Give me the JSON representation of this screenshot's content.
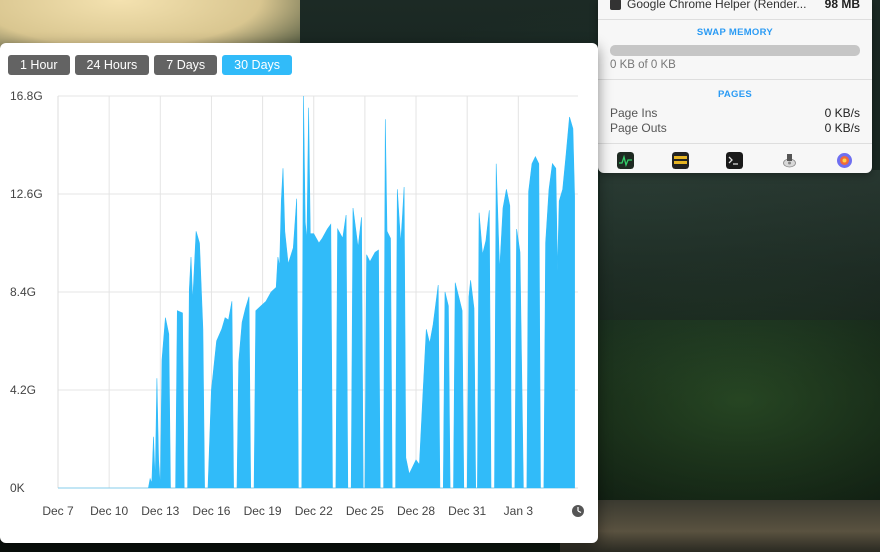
{
  "memory_panel": {
    "process_row": {
      "name": "Google Chrome Helper (Render...",
      "value": "98 MB"
    },
    "swap": {
      "heading": "SWAP MEMORY",
      "usage_text": "0 KB of 0 KB",
      "fill_fraction": 0
    },
    "pages": {
      "heading": "PAGES",
      "rows": [
        {
          "label": "Page Ins",
          "value": "0 KB/s"
        },
        {
          "label": "Page Outs",
          "value": "0 KB/s"
        }
      ]
    },
    "toolbar_icons": [
      "activity-monitor-icon",
      "console-icon",
      "terminal-icon",
      "disk-utility-icon",
      "system-preferences-icon"
    ]
  },
  "chart_window": {
    "range_tabs": [
      {
        "label": "1 Hour",
        "active": false
      },
      {
        "label": "24 Hours",
        "active": false
      },
      {
        "label": "7 Days",
        "active": false
      },
      {
        "label": "30 Days",
        "active": true
      }
    ],
    "history_icon": "clock-icon"
  },
  "chart_data": {
    "type": "area",
    "color": "#31bbf9",
    "y_unit": "G",
    "ylim": [
      0,
      16.8
    ],
    "y_ticks": [
      {
        "value": 16.8,
        "label": "16.8G"
      },
      {
        "value": 12.6,
        "label": "12.6G"
      },
      {
        "value": 8.4,
        "label": "8.4G"
      },
      {
        "value": 4.2,
        "label": "4.2G"
      },
      {
        "value": 0,
        "label": "0K"
      }
    ],
    "x_unit": "day offset from Dec 7",
    "xlim": [
      0,
      30.5
    ],
    "x_ticks": [
      {
        "value": 0,
        "label": "Dec 7"
      },
      {
        "value": 3,
        "label": "Dec 10"
      },
      {
        "value": 6,
        "label": "Dec 13"
      },
      {
        "value": 9,
        "label": "Dec 16"
      },
      {
        "value": 12,
        "label": "Dec 19"
      },
      {
        "value": 15,
        "label": "Dec 22"
      },
      {
        "value": 18,
        "label": "Dec 25"
      },
      {
        "value": 21,
        "label": "Dec 28"
      },
      {
        "value": 24,
        "label": "Dec 31"
      },
      {
        "value": 27,
        "label": "Jan 3"
      }
    ],
    "grid": true,
    "series": [
      {
        "name": "",
        "points": [
          [
            0,
            0
          ],
          [
            5.3,
            0
          ],
          [
            5.4,
            0.4
          ],
          [
            5.5,
            0.2
          ],
          [
            5.6,
            2.2
          ],
          [
            5.7,
            0.3
          ],
          [
            5.8,
            4.7
          ],
          [
            5.9,
            1.2
          ],
          [
            6.0,
            0
          ],
          [
            6.1,
            5.5
          ],
          [
            6.3,
            7.3
          ],
          [
            6.5,
            6.6
          ],
          [
            6.6,
            0
          ],
          [
            6.9,
            0
          ],
          [
            7.0,
            7.6
          ],
          [
            7.3,
            7.5
          ],
          [
            7.4,
            0
          ],
          [
            7.6,
            0
          ],
          [
            7.7,
            8.5
          ],
          [
            7.8,
            9.9
          ],
          [
            7.9,
            8.0
          ],
          [
            8.1,
            11.0
          ],
          [
            8.3,
            10.5
          ],
          [
            8.5,
            6.8
          ],
          [
            8.6,
            0
          ],
          [
            8.8,
            0
          ],
          [
            9.0,
            4.2
          ],
          [
            9.3,
            6.3
          ],
          [
            9.6,
            6.8
          ],
          [
            9.8,
            7.3
          ],
          [
            10.0,
            7.2
          ],
          [
            10.2,
            8.0
          ],
          [
            10.3,
            0
          ],
          [
            10.5,
            0
          ],
          [
            10.6,
            5.4
          ],
          [
            10.8,
            7.1
          ],
          [
            11.0,
            7.7
          ],
          [
            11.2,
            8.2
          ],
          [
            11.3,
            0
          ],
          [
            11.5,
            0
          ],
          [
            11.6,
            7.6
          ],
          [
            11.9,
            7.8
          ],
          [
            12.2,
            8.0
          ],
          [
            12.5,
            8.4
          ],
          [
            12.8,
            8.6
          ],
          [
            12.9,
            9.9
          ],
          [
            13.0,
            9.5
          ],
          [
            13.1,
            12.3
          ],
          [
            13.2,
            13.7
          ],
          [
            13.3,
            11.0
          ],
          [
            13.5,
            9.6
          ],
          [
            13.8,
            10.3
          ],
          [
            14.0,
            12.4
          ],
          [
            14.1,
            0
          ],
          [
            14.3,
            0
          ],
          [
            14.4,
            16.8
          ],
          [
            14.5,
            11.4
          ],
          [
            14.6,
            10.6
          ],
          [
            14.7,
            16.3
          ],
          [
            14.8,
            10.9
          ],
          [
            15.0,
            10.9
          ],
          [
            15.3,
            10.5
          ],
          [
            15.5,
            10.7
          ],
          [
            15.8,
            11.1
          ],
          [
            16.0,
            11.3
          ],
          [
            16.1,
            0
          ],
          [
            16.3,
            0
          ],
          [
            16.4,
            11.1
          ],
          [
            16.7,
            10.7
          ],
          [
            16.9,
            11.7
          ],
          [
            17.0,
            0
          ],
          [
            17.2,
            0
          ],
          [
            17.3,
            12.0
          ],
          [
            17.6,
            10.3
          ],
          [
            17.8,
            11.6
          ],
          [
            17.9,
            0
          ],
          [
            18.0,
            0
          ],
          [
            18.1,
            10.0
          ],
          [
            18.3,
            9.7
          ],
          [
            18.6,
            10.1
          ],
          [
            18.8,
            10.2
          ],
          [
            18.9,
            0
          ],
          [
            19.1,
            0
          ],
          [
            19.2,
            15.8
          ],
          [
            19.3,
            11.0
          ],
          [
            19.5,
            10.7
          ],
          [
            19.6,
            0
          ],
          [
            19.8,
            0
          ],
          [
            19.9,
            12.8
          ],
          [
            20.1,
            10.5
          ],
          [
            20.2,
            11.6
          ],
          [
            20.3,
            12.9
          ],
          [
            20.4,
            1.3
          ],
          [
            20.6,
            0.6
          ],
          [
            20.8,
            0.9
          ],
          [
            21.0,
            1.2
          ],
          [
            21.2,
            1.0
          ],
          [
            21.4,
            4.0
          ],
          [
            21.6,
            6.8
          ],
          [
            21.8,
            6.2
          ],
          [
            22.0,
            7.0
          ],
          [
            22.3,
            8.7
          ],
          [
            22.4,
            0
          ],
          [
            22.6,
            0
          ],
          [
            22.7,
            8.4
          ],
          [
            22.9,
            7.8
          ],
          [
            23.0,
            0
          ],
          [
            23.2,
            0
          ],
          [
            23.3,
            8.8
          ],
          [
            23.5,
            8.2
          ],
          [
            23.7,
            7.6
          ],
          [
            23.8,
            0
          ],
          [
            24.0,
            0
          ],
          [
            24.1,
            8.2
          ],
          [
            24.2,
            8.9
          ],
          [
            24.4,
            7.7
          ],
          [
            24.5,
            0
          ],
          [
            24.6,
            0
          ],
          [
            24.7,
            11.8
          ],
          [
            24.9,
            10.0
          ],
          [
            25.1,
            10.6
          ],
          [
            25.3,
            11.9
          ],
          [
            25.4,
            0
          ],
          [
            25.6,
            0
          ],
          [
            25.7,
            13.9
          ],
          [
            25.9,
            9.3
          ],
          [
            26.1,
            12.0
          ],
          [
            26.3,
            12.8
          ],
          [
            26.5,
            12.1
          ],
          [
            26.6,
            0
          ],
          [
            26.8,
            0
          ],
          [
            26.9,
            11.1
          ],
          [
            27.1,
            10.1
          ],
          [
            27.3,
            0
          ],
          [
            27.5,
            0
          ],
          [
            27.6,
            12.7
          ],
          [
            27.8,
            13.9
          ],
          [
            28.0,
            14.2
          ],
          [
            28.2,
            13.9
          ],
          [
            28.3,
            0
          ],
          [
            28.5,
            0
          ],
          [
            28.6,
            10.5
          ],
          [
            28.8,
            12.8
          ],
          [
            29.0,
            13.9
          ],
          [
            29.2,
            13.7
          ],
          [
            29.3,
            9.3
          ],
          [
            29.4,
            12.3
          ],
          [
            29.6,
            12.8
          ],
          [
            29.8,
            14.3
          ],
          [
            30.0,
            15.9
          ],
          [
            30.2,
            15.4
          ],
          [
            30.3,
            12.5
          ],
          [
            30.3,
            0
          ]
        ]
      }
    ]
  }
}
